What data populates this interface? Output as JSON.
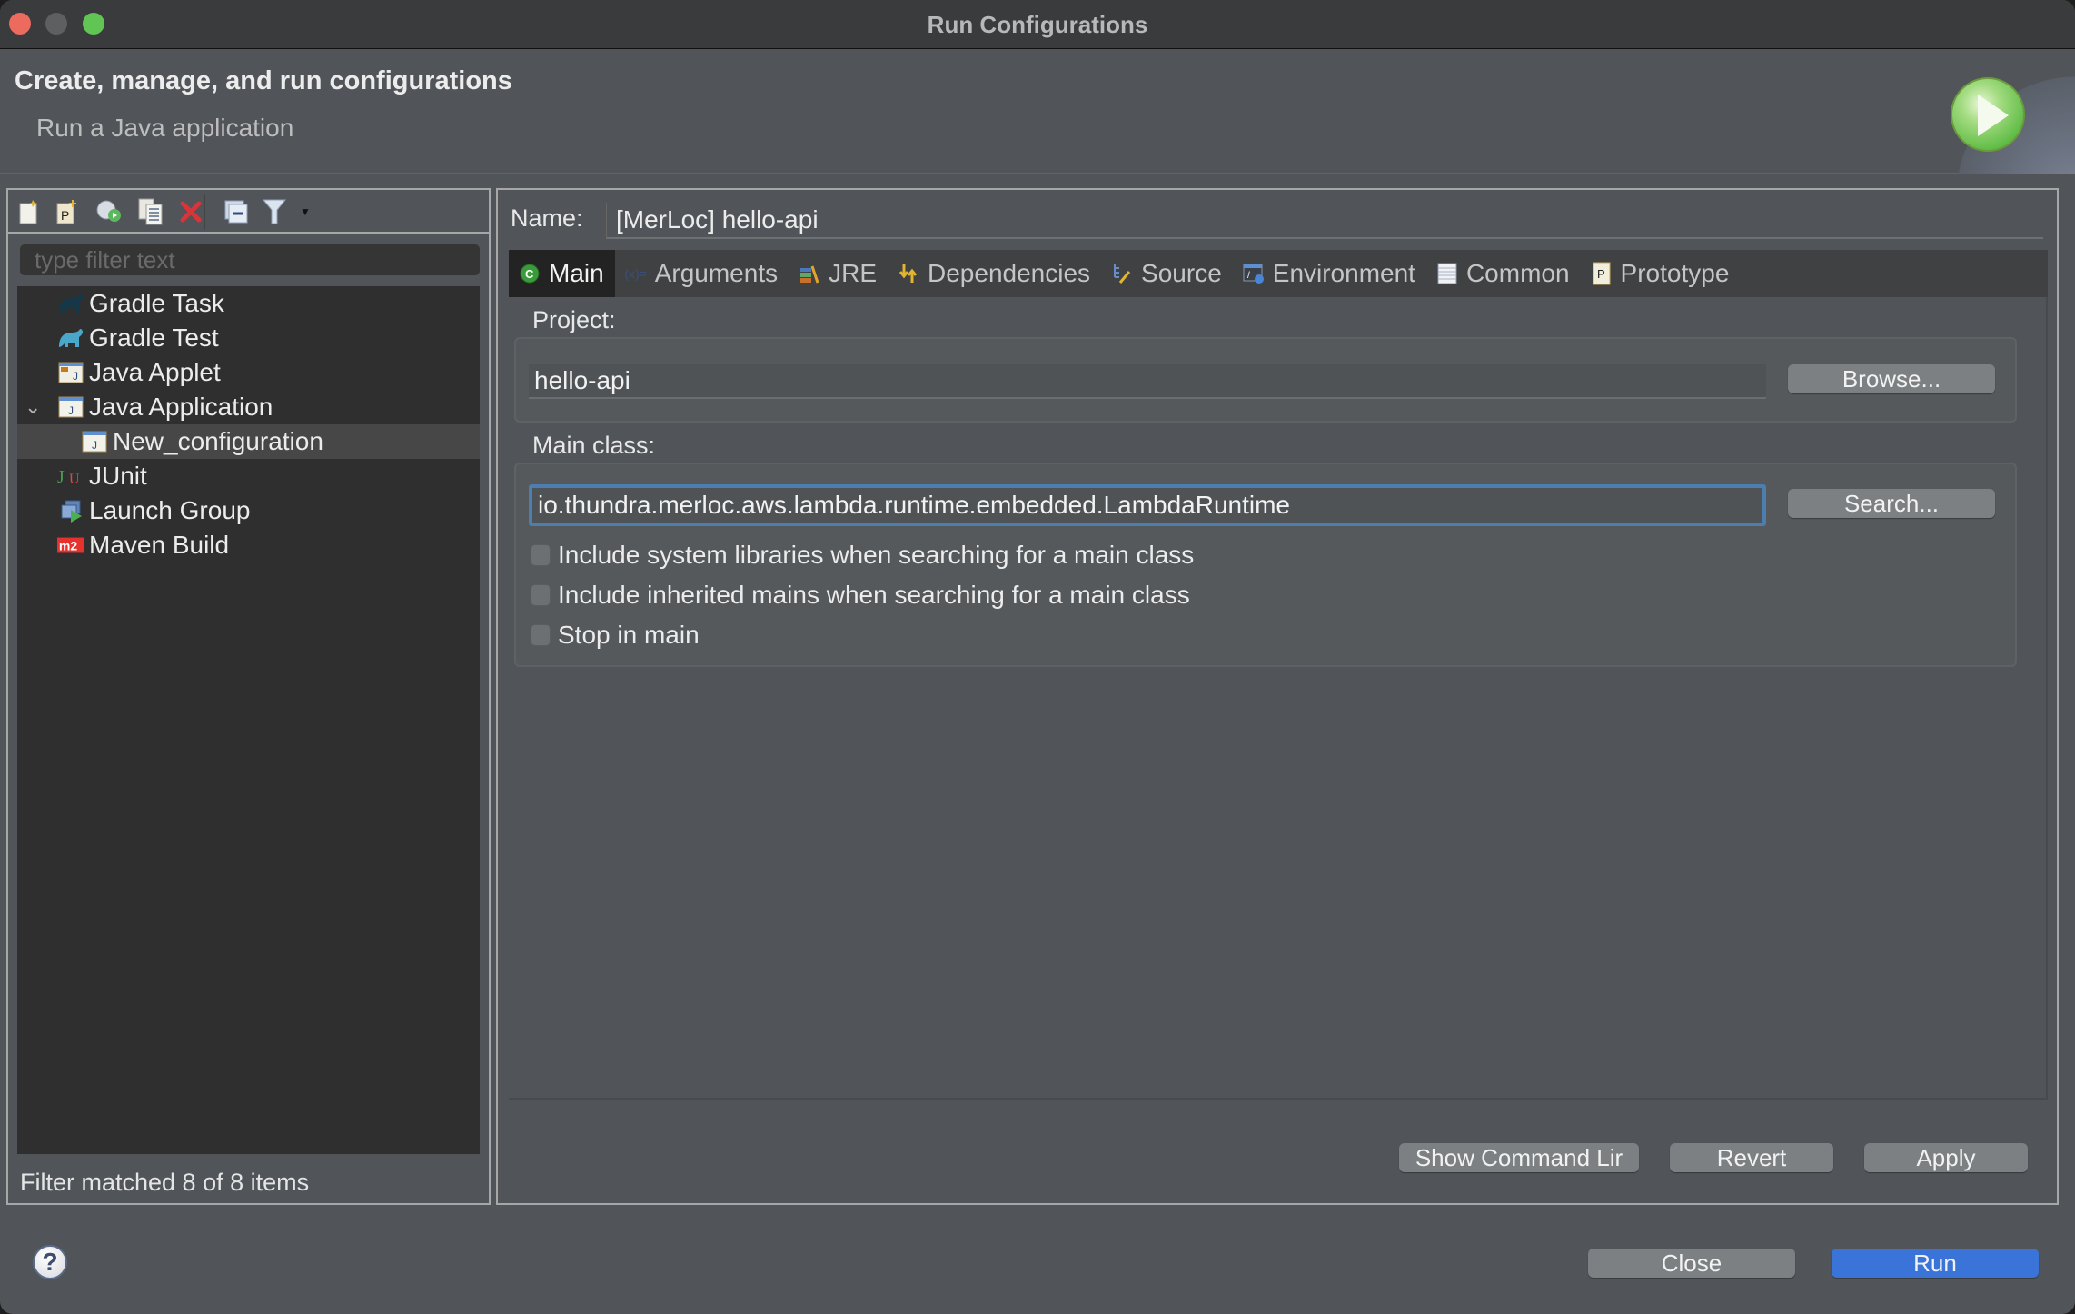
{
  "window": {
    "title": "Run Configurations"
  },
  "header": {
    "title": "Create, manage, and run configurations",
    "subtitle": "Run a Java application",
    "icon": "run-orb-icon"
  },
  "left_panel": {
    "toolbar": [
      {
        "name": "new-configuration",
        "icon": "new-launch-config-icon"
      },
      {
        "name": "new-prototype",
        "icon": "new-prototype-icon"
      },
      {
        "name": "export",
        "icon": "export-launch-config-icon"
      },
      {
        "name": "duplicate",
        "icon": "duplicate-icon"
      },
      {
        "name": "delete",
        "icon": "delete-icon"
      },
      {
        "name": "collapse-all",
        "icon": "collapse-all-icon"
      },
      {
        "name": "filter",
        "icon": "filter-icon"
      }
    ],
    "filter": {
      "placeholder": "type filter text",
      "value": ""
    },
    "tree": [
      {
        "label": "Gradle Task",
        "icon": "gradle-task-icon",
        "level": 0
      },
      {
        "label": "Gradle Test",
        "icon": "gradle-test-icon",
        "level": 0
      },
      {
        "label": "Java Applet",
        "icon": "java-applet-icon",
        "level": 0
      },
      {
        "label": "Java Application",
        "icon": "java-application-icon",
        "level": 0,
        "expanded": true
      },
      {
        "label": "New_configuration",
        "icon": "java-application-icon",
        "level": 1,
        "selected": true
      },
      {
        "label": "JUnit",
        "icon": "junit-icon",
        "level": 0
      },
      {
        "label": "Launch Group",
        "icon": "launch-group-icon",
        "level": 0
      },
      {
        "label": "Maven Build",
        "icon": "maven-icon",
        "level": 0
      }
    ],
    "status": "Filter matched 8 of 8 items"
  },
  "right_panel": {
    "name_label": "Name:",
    "name_value": "[MerLoc] hello-api",
    "tabs": [
      {
        "label": "Main",
        "icon": "main-class-icon",
        "active": true
      },
      {
        "label": "Arguments",
        "icon": "arguments-icon"
      },
      {
        "label": "JRE",
        "icon": "jre-icon"
      },
      {
        "label": "Dependencies",
        "icon": "dependencies-icon"
      },
      {
        "label": "Source",
        "icon": "source-icon"
      },
      {
        "label": "Environment",
        "icon": "environment-icon"
      },
      {
        "label": "Common",
        "icon": "common-icon"
      },
      {
        "label": "Prototype",
        "icon": "prototype-icon"
      }
    ],
    "main_tab": {
      "project_label": "Project:",
      "project_value": "hello-api",
      "browse_label": "Browse...",
      "main_class_label": "Main class:",
      "main_class_value": "io.thundra.merloc.aws.lambda.runtime.embedded.LambdaRuntime",
      "search_label": "Search...",
      "checkboxes": [
        {
          "label": "Include system libraries when searching for a main class",
          "checked": false
        },
        {
          "label": "Include inherited mains when searching for a main class",
          "checked": false
        },
        {
          "label": "Stop in main",
          "checked": false
        }
      ]
    },
    "buttons": {
      "show_command_line": "Show Command Lir",
      "revert": "Revert",
      "apply": "Apply"
    }
  },
  "footer": {
    "close": "Close",
    "run": "Run",
    "colors": {
      "run_accent": "#3b74d8",
      "focus_border": "#4c7eaf"
    }
  }
}
